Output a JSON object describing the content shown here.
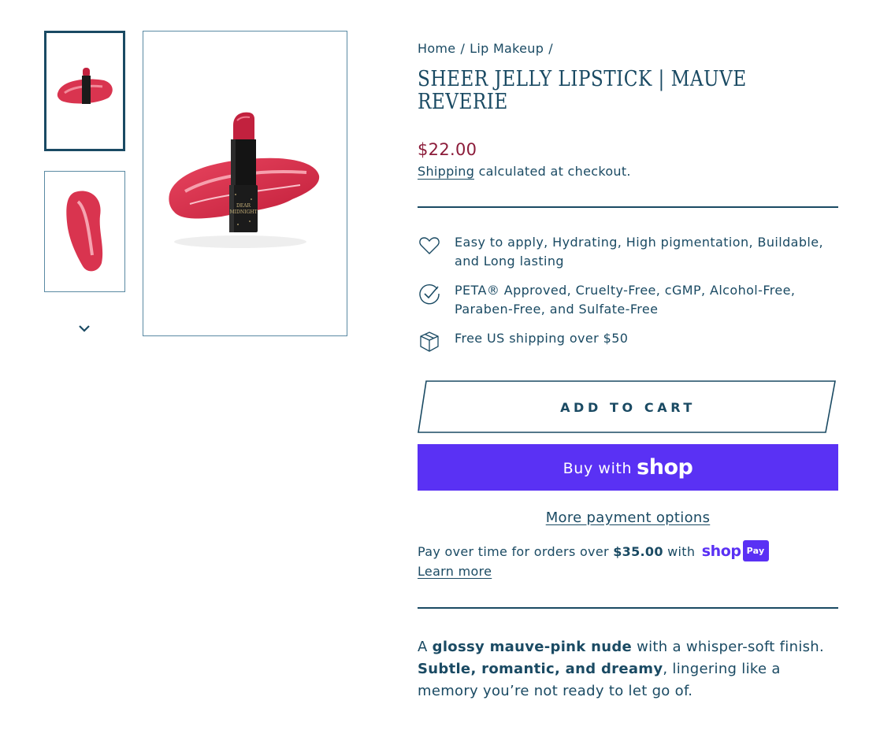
{
  "gallery": {
    "thumbnails": [
      {
        "icon": "lipstick-product-image",
        "active": true
      },
      {
        "icon": "lipstick-swatch-image",
        "active": false
      }
    ],
    "scroll_icon": "chevron-down-icon",
    "main_image_icon": "lipstick-product-image",
    "brand_on_tube": "DEAR MIDNIGHT"
  },
  "breadcrumb": {
    "home": "Home",
    "category": "Lip Makeup",
    "separator": "/"
  },
  "product": {
    "title": "Sheer Jelly Lipstick | Mauve Reverie",
    "price": "$22.00",
    "shipping_link": "Shipping",
    "shipping_text": " calculated at checkout."
  },
  "features": [
    {
      "icon": "heart-icon",
      "text": "Easy to apply, Hydrating, High pigmentation, Buildable, and Long lasting"
    },
    {
      "icon": "check-circle-icon",
      "text": "PETA® Approved, Cruelty-Free, cGMP, Alcohol-Free, Paraben-Free, and Sulfate-Free"
    },
    {
      "icon": "box-icon",
      "text": "Free US shipping over $50"
    }
  ],
  "actions": {
    "add_to_cart": "ADD TO CART",
    "buy_with": "Buy with",
    "shop_word": "shop",
    "more_payment": "More payment options"
  },
  "installments": {
    "prefix": "Pay over time for orders over ",
    "amount": "$35.00",
    "with": " with ",
    "shop_word": "shop",
    "pay_badge": "Pay",
    "learn_more": "Learn more"
  },
  "description": {
    "p1_a": "A ",
    "p1_b": "glossy mauve-pink nude",
    "p1_c": " with a whisper-soft finish.",
    "p2_a": "Subtle, romantic, and dreamy",
    "p2_b": ", lingering like a memory you’re not ready to let go of."
  },
  "colors": {
    "primary": "#1a4a63",
    "price": "#8c1c3a",
    "shop_purple": "#5a31f4",
    "lipstick": "#d9344f"
  }
}
